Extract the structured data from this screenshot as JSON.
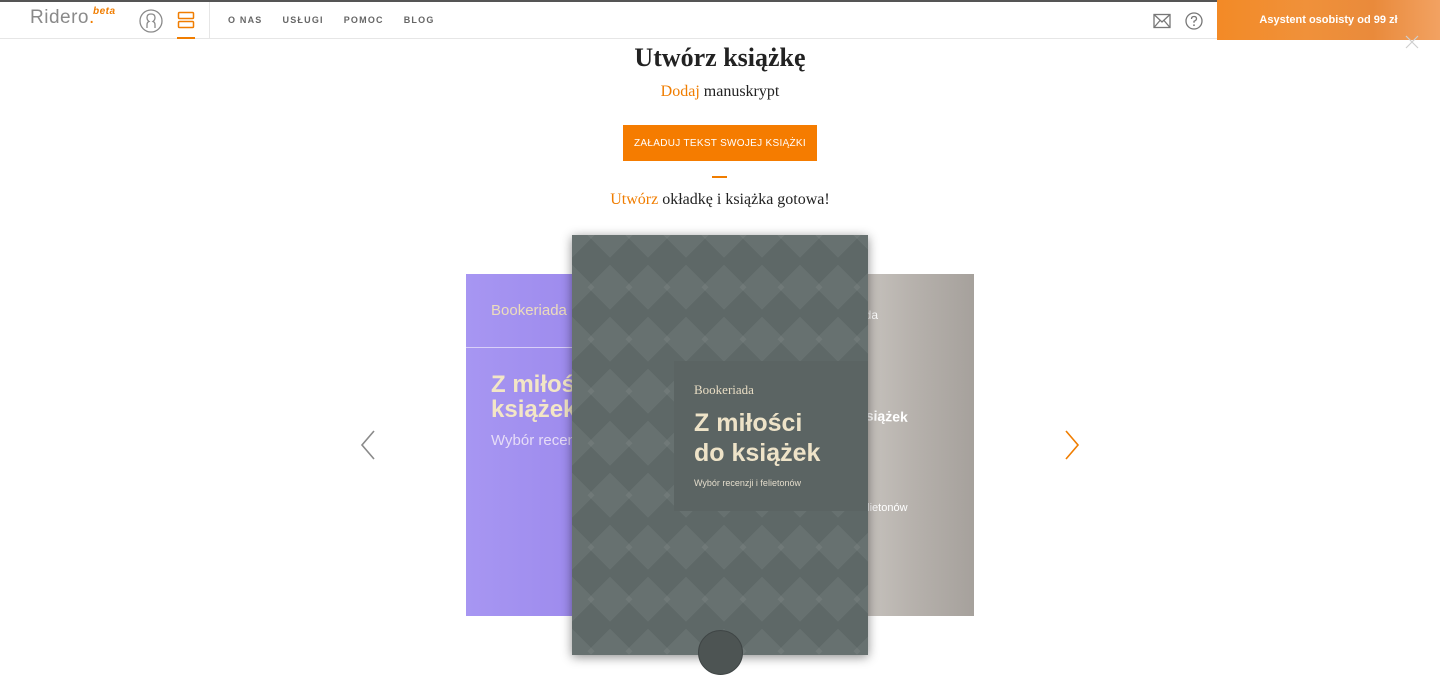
{
  "header": {
    "logo": "Ridero",
    "logo_badge": "beta",
    "nav": [
      "O NAS",
      "USŁUGI",
      "POMOC",
      "BLOG"
    ],
    "promo": "Asystent osobisty od 99 zł"
  },
  "main": {
    "title": "Utwórz książkę",
    "step1_accent": "Dodaj",
    "step1_rest": "manuskrypt",
    "upload_button": "ZAŁADUJ TEKST SWOJEJ KSIĄŻKI",
    "step2_accent": "Utwórz",
    "step2_rest": "okładkę i książka gotowa!"
  },
  "carousel": {
    "left_card": {
      "author": "Bookeriada",
      "title_line1": "Z miłości",
      "title_line2": "książek",
      "subtitle": "Wybór recen",
      "color": "#a796f2"
    },
    "main_card": {
      "author": "Bookeriada",
      "title_line1": "Z miłości",
      "title_line2": "do książek",
      "subtitle": "Wybór recenzji i felietonów",
      "color": "#5e6867"
    },
    "right_card": {
      "author": "ada",
      "title": "książek",
      "subtitle": "felietonów",
      "color": "#b6b1ac"
    }
  },
  "icons": {
    "user": "user-icon",
    "menu": "menu-icon",
    "mail": "mail-icon",
    "help": "help-icon",
    "close": "close-icon",
    "prev": "chevron-left-icon",
    "next": "chevron-right-icon"
  },
  "colors": {
    "accent": "#f07d00",
    "button": "#f57c00"
  }
}
